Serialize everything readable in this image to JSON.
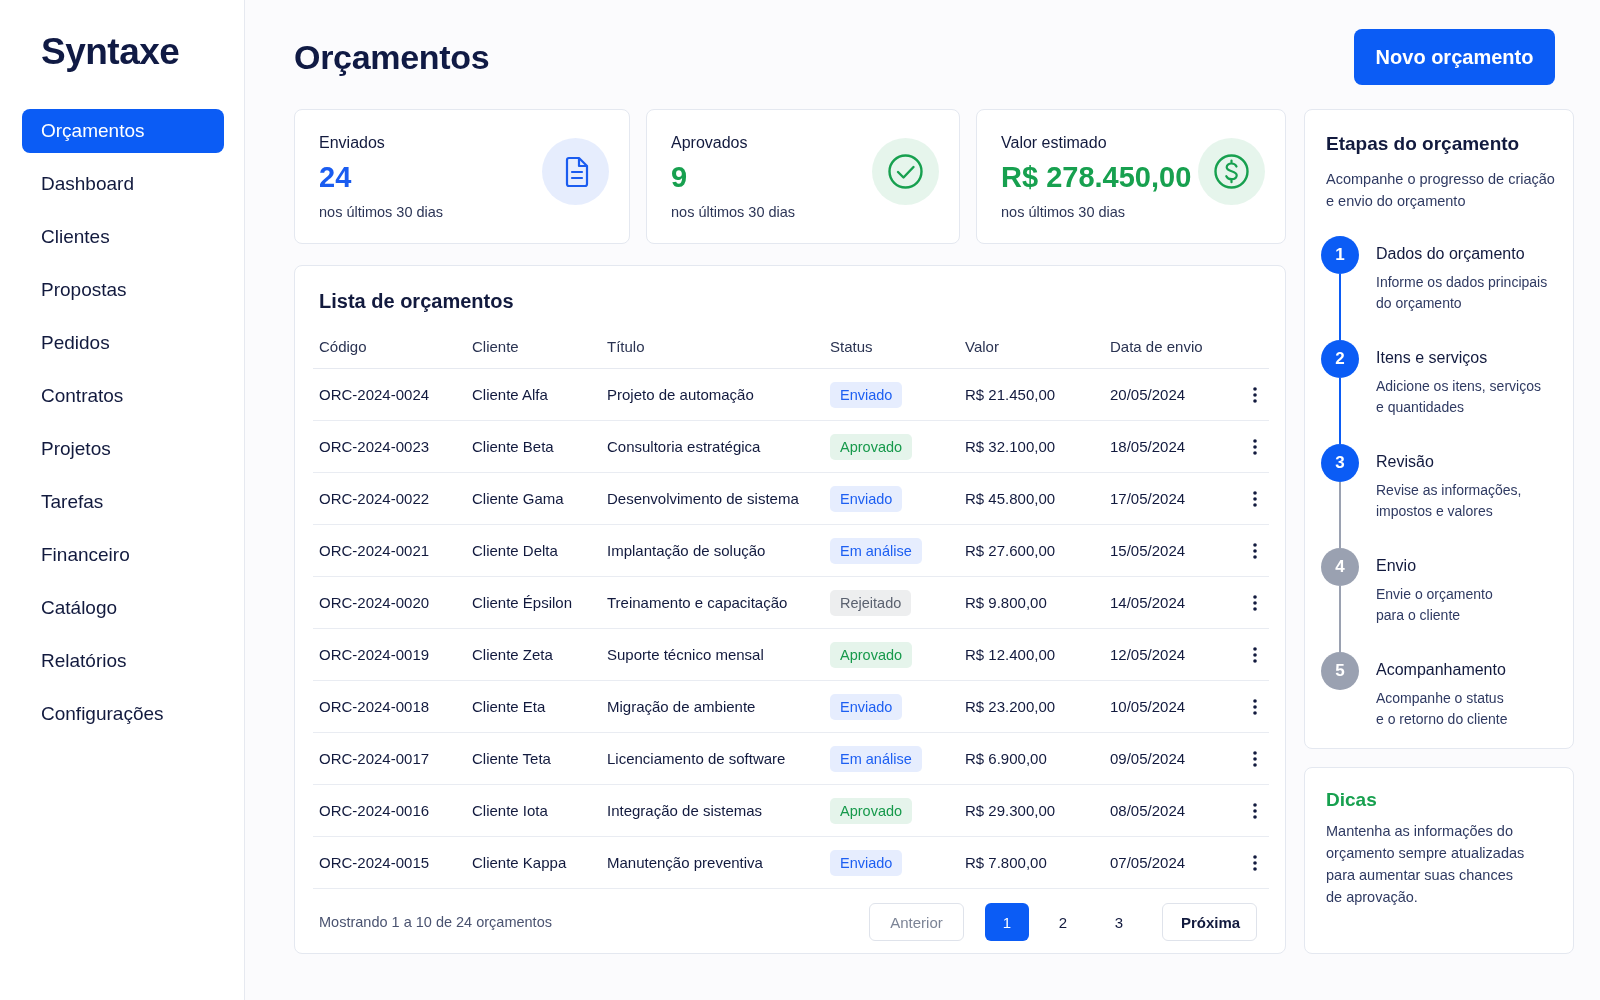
{
  "sidebar": {
    "logo": "Syntaxe",
    "items": [
      {
        "label": "Orçamentos",
        "selected": true
      },
      {
        "label": "Dashboard",
        "selected": false
      },
      {
        "label": "Clientes",
        "selected": false
      },
      {
        "label": "Propostas",
        "selected": false
      },
      {
        "label": "Pedidos",
        "selected": false
      },
      {
        "label": "Contratos",
        "selected": false
      },
      {
        "label": "Projetos",
        "selected": false
      },
      {
        "label": "Tarefas",
        "selected": false
      },
      {
        "label": "Financeiro",
        "selected": false
      },
      {
        "label": "Catálogo",
        "selected": false
      },
      {
        "label": "Relatórios",
        "selected": false
      },
      {
        "label": "Configurações",
        "selected": false
      }
    ]
  },
  "header": {
    "title": "Orçamentos",
    "primary_button": "Novo orçamento"
  },
  "stats": [
    {
      "kind": "document",
      "label": "Enviados",
      "value": "24",
      "caption": "nos últimos 30 dias",
      "color": "#1a5cf0"
    },
    {
      "kind": "check",
      "label": "Aprovados",
      "value": "9",
      "caption": "nos últimos 30 dias",
      "color": "#17a04f"
    },
    {
      "kind": "money",
      "label": "Valor estimado",
      "value": "R$ 278.450,00",
      "caption": "nos últimos 30 dias",
      "color": "#17a04f"
    }
  ],
  "table": {
    "title": "Lista de orçamentos",
    "columns": [
      "Código",
      "Cliente",
      "Título",
      "Status",
      "Valor",
      "Data de envio"
    ],
    "rows": [
      {
        "code": "ORC-2024-0024",
        "client": "Cliente Alfa",
        "title": "Projeto de automação",
        "status": {
          "label": "Enviado",
          "color": "#1d5ff2"
        },
        "value": "R$ 21.450,00",
        "date": "20/05/2024"
      },
      {
        "code": "ORC-2024-0023",
        "client": "Cliente Beta",
        "title": "Consultoria estratégica",
        "status": {
          "label": "Aprovado",
          "color": "#16994b"
        },
        "value": "R$ 32.100,00",
        "date": "18/05/2024"
      },
      {
        "code": "ORC-2024-0022",
        "client": "Cliente Gama",
        "title": "Desenvolvimento de sistema",
        "status": {
          "label": "Enviado",
          "color": "#1d5ff2"
        },
        "value": "R$ 45.800,00",
        "date": "17/05/2024"
      },
      {
        "code": "ORC-2024-0021",
        "client": "Cliente Delta",
        "title": "Implantação de solução",
        "status": {
          "label": "Em análise",
          "color": "#1d5ff2"
        },
        "value": "R$ 27.600,00",
        "date": "15/05/2024"
      },
      {
        "code": "ORC-2024-0020",
        "client": "Cliente Épsilon",
        "title": "Treinamento e capacitação",
        "status": {
          "label": "Rejeitado",
          "color": "#5a616f"
        },
        "value": "R$ 9.800,00",
        "date": "14/05/2024"
      },
      {
        "code": "ORC-2024-0019",
        "client": "Cliente Zeta",
        "title": "Suporte técnico mensal",
        "status": {
          "label": "Aprovado",
          "color": "#16994b"
        },
        "value": "R$ 12.400,00",
        "date": "12/05/2024"
      },
      {
        "code": "ORC-2024-0018",
        "client": "Cliente Eta",
        "title": "Migração de ambiente",
        "status": {
          "label": "Enviado",
          "color": "#1d5ff2"
        },
        "value": "R$ 23.200,00",
        "date": "10/05/2024"
      },
      {
        "code": "ORC-2024-0017",
        "client": "Cliente Teta",
        "title": "Licenciamento de software",
        "status": {
          "label": "Em análise",
          "color": "#1d5ff2"
        },
        "value": "R$ 6.900,00",
        "date": "09/05/2024"
      },
      {
        "code": "ORC-2024-0016",
        "client": "Cliente Iota",
        "title": "Integração de sistemas",
        "status": {
          "label": "Aprovado",
          "color": "#16994b"
        },
        "value": "R$ 29.300,00",
        "date": "08/05/2024"
      },
      {
        "code": "ORC-2024-0015",
        "client": "Cliente Kappa",
        "title": "Manutenção preventiva",
        "status": {
          "label": "Enviado",
          "color": "#1d5ff2"
        },
        "value": "R$ 7.800,00",
        "date": "07/05/2024"
      }
    ],
    "summary": "Mostrando 1 a 10 de 24 orçamentos",
    "pagination": {
      "previous": {
        "label": "Anterior",
        "disabled": true
      },
      "pages": [
        {
          "label": "1",
          "selected": true
        },
        {
          "label": "2",
          "selected": false
        },
        {
          "label": "3",
          "selected": false
        }
      ],
      "next": {
        "label": "Próxima",
        "disabled": false
      }
    }
  },
  "steps_panel": {
    "title": "Etapas do orçamento",
    "subtitle": "Acompanhe o progresso de criação\ne envio do orçamento",
    "steps": [
      {
        "number": "1",
        "title": "Dados do orçamento",
        "description": "Informe os dados principais\ndo orçamento",
        "active": true
      },
      {
        "number": "2",
        "title": "Itens e serviços",
        "description": "Adicione os itens, serviços\ne quantidades",
        "active": true
      },
      {
        "number": "3",
        "title": "Revisão",
        "description": "Revise as informações,\nimpostos e valores",
        "active": true
      },
      {
        "number": "4",
        "title": "Envio",
        "description": "Envie o orçamento\npara o cliente",
        "active": false
      },
      {
        "number": "5",
        "title": "Acompanhamento",
        "description": "Acompanhe o status\ne o retorno do cliente",
        "active": false
      }
    ]
  },
  "tips": {
    "title": "Dicas",
    "text": "Mantenha as informações do\norçamento sempre atualizadas\npara aumentar suas chances\nde aprovação."
  }
}
